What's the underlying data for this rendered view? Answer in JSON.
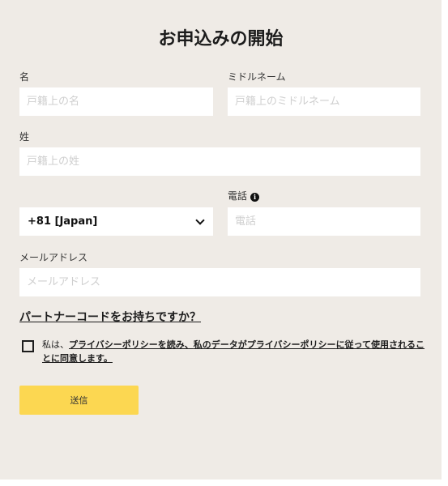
{
  "form": {
    "title": "お申込みの開始",
    "fields": {
      "first_name": {
        "label": "名",
        "placeholder": "戸籍上の名"
      },
      "middle_name": {
        "label": "ミドルネーム",
        "placeholder": "戸籍上のミドルネーム"
      },
      "last_name": {
        "label": "姓",
        "placeholder": "戸籍上の姓"
      },
      "country_code": {
        "value": "+81 [Japan]"
      },
      "phone": {
        "label": "電話",
        "placeholder": "電話",
        "info_icon": "i"
      },
      "email": {
        "label": "メールアドレス",
        "placeholder": "メールアドレス"
      }
    },
    "partner_link": "パートナーコードをお持ちですか？",
    "consent": {
      "prefix": "私は、",
      "link1": "プライバシーポリシーを読み、",
      "middle": "私のデータが",
      "link2": "プライバシーポリシー",
      "link3": "に従って使用されることに同意します。",
      "checked": false
    },
    "submit_label": "送信"
  },
  "colors": {
    "background": "#efebe6",
    "submit": "#fcd751",
    "input": "#ffffff"
  }
}
